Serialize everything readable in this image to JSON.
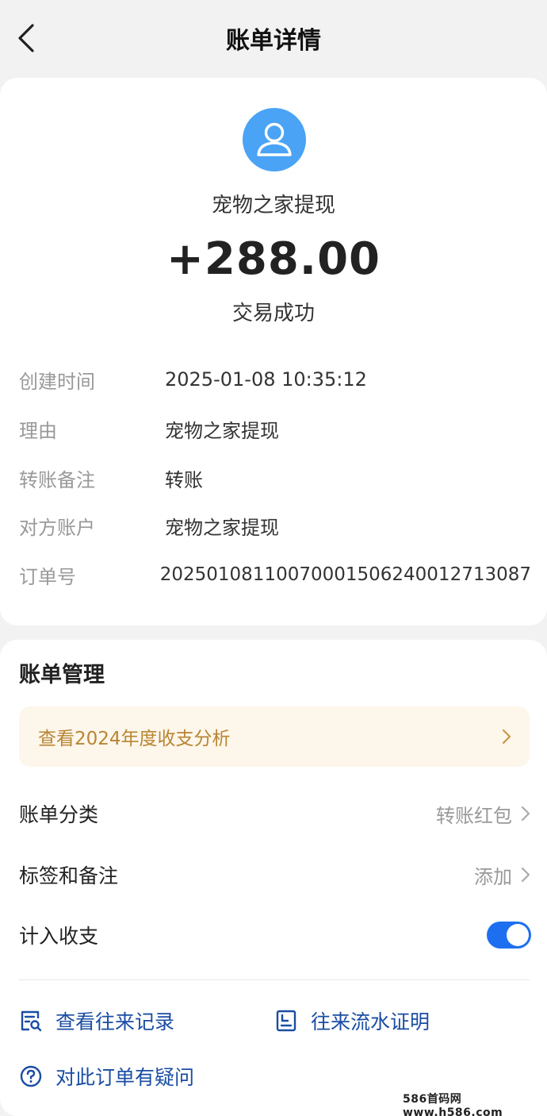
{
  "nav": {
    "title": "账单详情"
  },
  "summary": {
    "payee": "宠物之家提现",
    "amount": "+288.00",
    "status": "交易成功"
  },
  "details": [
    {
      "label": "创建时间",
      "value": "2025-01-08 10:35:12"
    },
    {
      "label": "理由",
      "value": "宠物之家提现"
    },
    {
      "label": "转账备注",
      "value": "转账"
    },
    {
      "label": "对方账户",
      "value": "宠物之家提现"
    },
    {
      "label": "订单号",
      "value": "20250108110070001506240012713087"
    }
  ],
  "management": {
    "title": "账单管理",
    "banner": "查看2024年度收支分析",
    "category_label": "账单分类",
    "category_value": "转账红包",
    "tags_label": "标签和备注",
    "tags_value": "添加",
    "include_label": "计入收支",
    "include_enabled": true
  },
  "actions": {
    "history": "查看往来记录",
    "statement": "往来流水证明",
    "question": "对此订单有疑问"
  },
  "watermark": "586首码网 www.h586.com",
  "colors": {
    "accent": "#1e6ff0",
    "avatar": "#4aa3f5",
    "banner_text": "#b88535",
    "link": "#1a4da3"
  }
}
